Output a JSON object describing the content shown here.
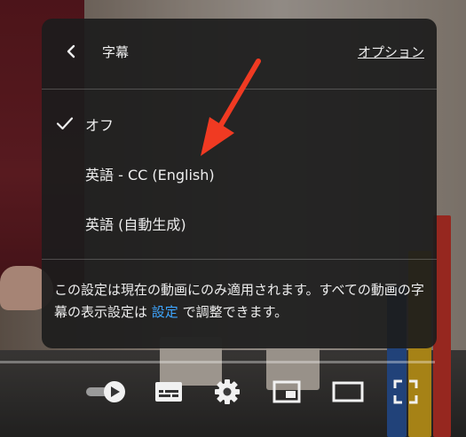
{
  "subtitles_menu": {
    "title": "字幕",
    "options_link": "オプション",
    "items": [
      {
        "label": "オフ",
        "selected": true
      },
      {
        "label": "英語 - CC (English)",
        "selected": false
      },
      {
        "label": "英語 (自動生成)",
        "selected": false
      }
    ],
    "info_text_before": "この設定は現在の動画にのみ適用されます。すべての動画の字幕の表示設定は ",
    "info_link": "設定",
    "info_text_after": " で調整できます。"
  },
  "controls": {
    "autoplay_toggle": "autoplay-toggle-icon",
    "subtitles": "subtitles-icon",
    "settings": "gear-icon",
    "miniplayer": "miniplayer-icon",
    "theater": "theater-mode-icon",
    "fullscreen": "fullscreen-icon"
  },
  "colors": {
    "panel_bg": "#1c1c1c",
    "link": "#3ea6ff",
    "annotation_arrow": "#f03a22"
  }
}
